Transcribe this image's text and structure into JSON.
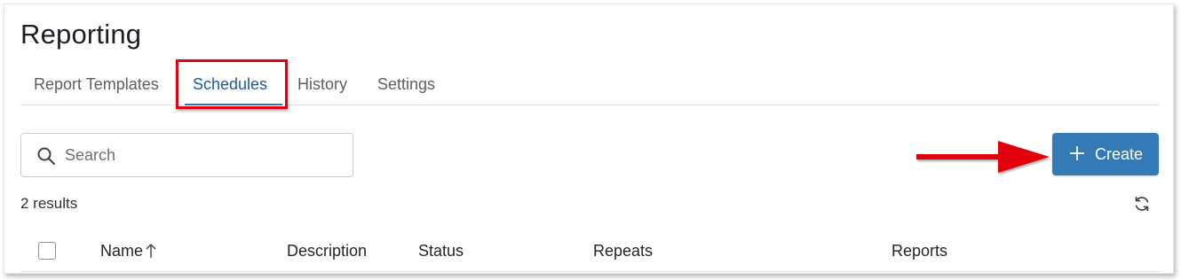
{
  "page": {
    "title": "Reporting"
  },
  "tabs": [
    {
      "label": "Report Templates",
      "active": false
    },
    {
      "label": "Schedules",
      "active": true
    },
    {
      "label": "History",
      "active": false
    },
    {
      "label": "Settings",
      "active": false
    }
  ],
  "search": {
    "placeholder": "Search",
    "value": "",
    "icon": "search-icon"
  },
  "toolbar": {
    "create_label": "Create",
    "create_icon": "plus-icon"
  },
  "results": {
    "text": "2 results",
    "refresh_icon": "refresh-icon"
  },
  "table": {
    "columns": [
      {
        "label": "Name",
        "sort": "ascending"
      },
      {
        "label": "Description"
      },
      {
        "label": "Status"
      },
      {
        "label": "Repeats"
      },
      {
        "label": "Reports"
      }
    ]
  },
  "annotations": {
    "highlight_color": "#e3000b",
    "arrow_color": "#e3000b"
  },
  "colors": {
    "accent": "#337ab7",
    "active_tab_text": "#1f5a97"
  }
}
